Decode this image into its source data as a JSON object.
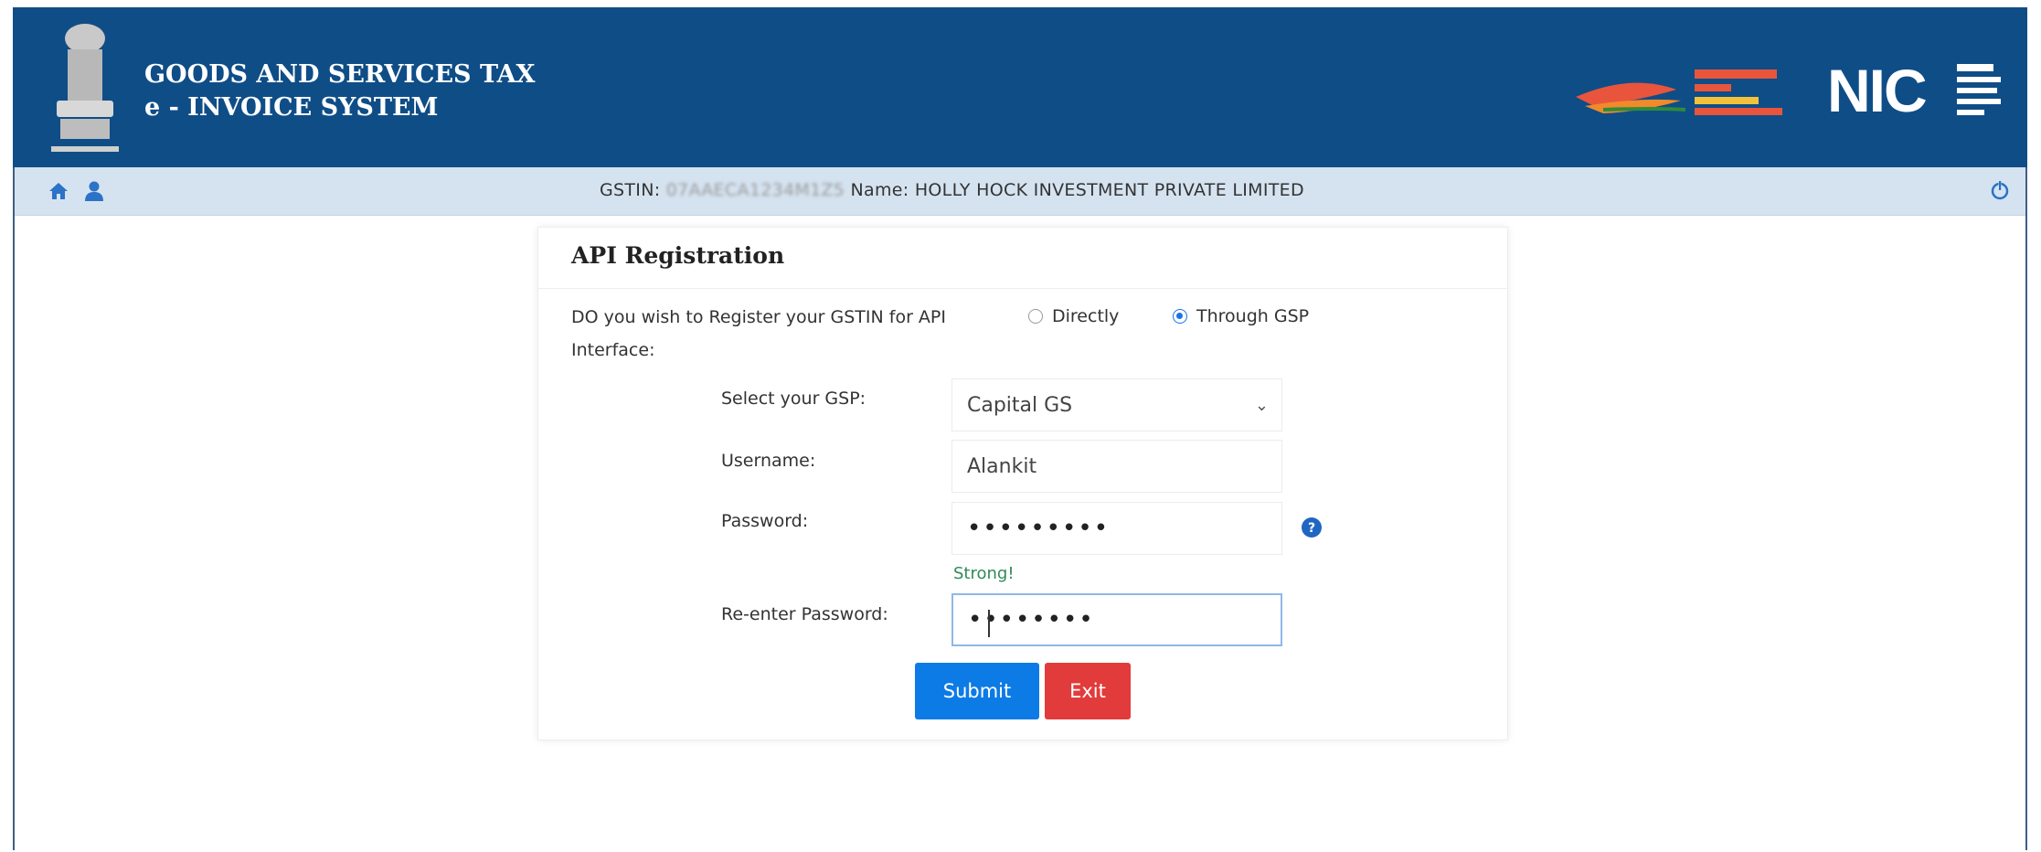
{
  "header": {
    "title_line1": "GOODS AND SERVICES TAX",
    "title_line2": "e - INVOICE SYSTEM",
    "brand_color": "#0f4d87"
  },
  "subbar": {
    "gstin_label": "GSTIN:",
    "gstin_value": "07AAECA1234M1Z5",
    "name_label": "Name:",
    "name_value": "HOLLY HOCK INVESTMENT PRIVATE LIMITED",
    "icons": [
      "home-icon",
      "user-icon",
      "power-icon"
    ]
  },
  "card": {
    "title": "API Registration",
    "question": "DO you wish to Register your GSTIN for API Interface:",
    "options": [
      {
        "label": "Directly",
        "checked": false
      },
      {
        "label": "Through GSP",
        "checked": true
      }
    ],
    "gsp_label": "Select your GSP:",
    "gsp_value": "Capital  GS",
    "username_label": "Username:",
    "username_value": "Alankit",
    "password_label": "Password:",
    "password_value": "•••••••••",
    "strength": "Strong!",
    "reenter_label": "Re-enter Password:",
    "reenter_value": "••••••••",
    "submit_label": "Submit",
    "exit_label": "Exit"
  }
}
